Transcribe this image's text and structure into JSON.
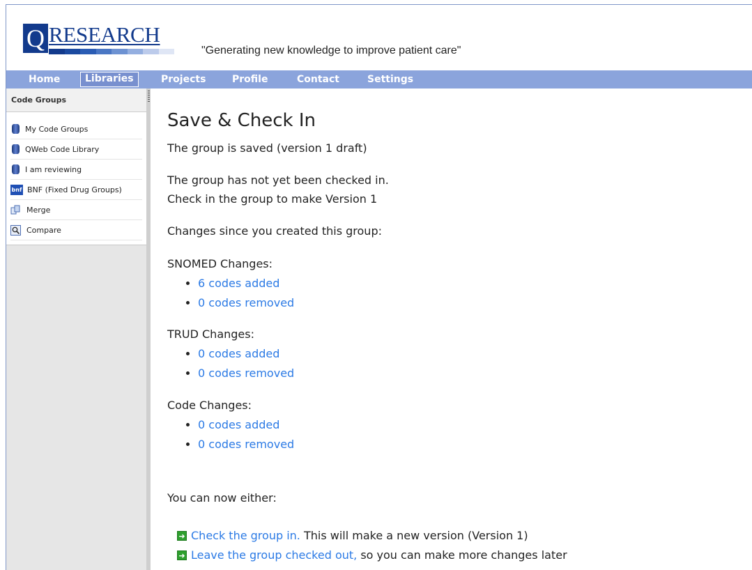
{
  "header": {
    "logo_q": "Q",
    "logo_text": "RESEARCH",
    "tagline": "\"Generating new knowledge to improve patient care\"",
    "logo_bar_colors": [
      "#123a8c",
      "#1b4aa0",
      "#2a5cb4",
      "#4a77c4",
      "#6d92d2",
      "#94afe0",
      "#bccbeb",
      "#dfe6f5"
    ]
  },
  "nav": {
    "items": [
      "Home",
      "Libraries",
      "Projects",
      "Profile",
      "Contact",
      "Settings"
    ],
    "active": "Libraries"
  },
  "sidebar": {
    "title": "Code Groups",
    "items": [
      {
        "label": "My Code Groups",
        "icon": "database-icon"
      },
      {
        "label": "QWeb Code Library",
        "icon": "database-icon"
      },
      {
        "label": "I am reviewing",
        "icon": "database-icon"
      },
      {
        "label": "BNF (Fixed Drug Groups)",
        "icon": "bnf-icon",
        "icon_text": "bnf"
      },
      {
        "label": "Merge",
        "icon": "merge-icon"
      },
      {
        "label": "Compare",
        "icon": "compare-icon"
      }
    ]
  },
  "main": {
    "title": "Save & Check In",
    "saved_msg": "The group is saved (version 1 draft)",
    "not_checked_in": "The group has not yet been checked in.",
    "check_in_hint": "Check in the group to make Version 1",
    "changes_intro": "Changes since you created this group:",
    "sections": [
      {
        "heading": "SNOMED Changes:",
        "added": "6 codes added",
        "removed": "0 codes removed"
      },
      {
        "heading": "TRUD Changes:",
        "added": "0 codes added",
        "removed": "0 codes removed"
      },
      {
        "heading": "Code Changes:",
        "added": "0 codes added",
        "removed": "0 codes removed"
      }
    ],
    "either": "You can now either:",
    "actions": [
      {
        "link": "Check the group in.",
        "rest": " This will make a new version (Version 1)"
      },
      {
        "link": "Leave the group checked out,",
        "rest": " so you can make more changes later"
      }
    ]
  },
  "colors": {
    "nav_bg": "#8ba4dc",
    "link": "#2b7ae5",
    "brand": "#123a8c",
    "action_arrow": "#2e9f2e"
  }
}
